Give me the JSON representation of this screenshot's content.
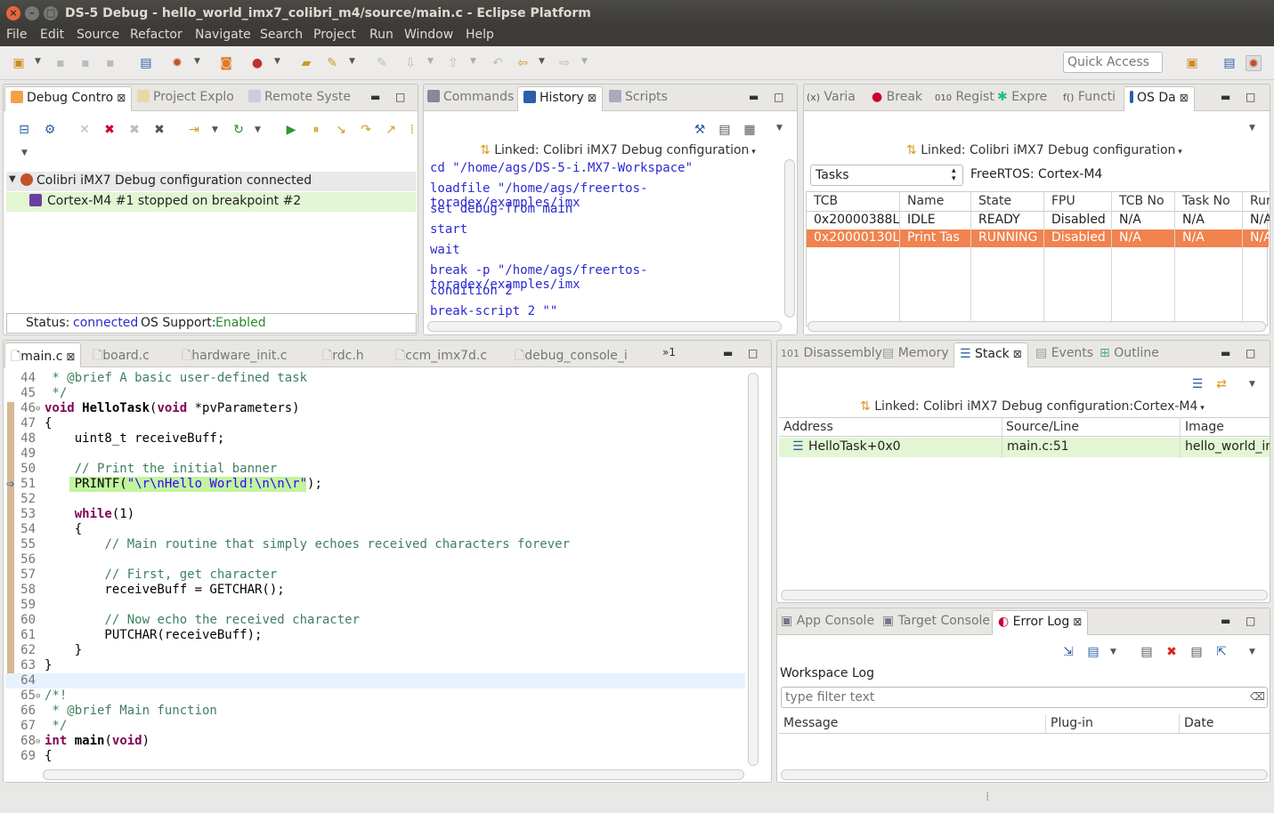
{
  "window": {
    "title": "DS-5 Debug - hello_world_imx7_colibri_m4/source/main.c - Eclipse Platform"
  },
  "menu": [
    "File",
    "Edit",
    "Source",
    "Refactor",
    "Navigate",
    "Search",
    "Project",
    "Run",
    "Window",
    "Help"
  ],
  "toolbar": {
    "quick_access_placeholder": "Quick Access"
  },
  "debug_panel": {
    "tabs": [
      "Debug Contro",
      "Project Explo",
      "Remote Syste"
    ],
    "connection": "Colibri iMX7 Debug configuration connected",
    "target": "Cortex-M4 #1 stopped on breakpoint #2",
    "status_label": "Status:",
    "status_value": "connected",
    "os_label": "OS Support:",
    "os_value": "Enabled"
  },
  "history_panel": {
    "tabs": [
      "Commands",
      "History",
      "Scripts"
    ],
    "linked": "Linked: Colibri iMX7 Debug configuration",
    "commands": [
      "cd \"/home/ags/DS-5-i.MX7-Workspace\"",
      "loadfile \"/home/ags/freertos-toradex/examples/imx",
      "set debug-from main",
      "start",
      "wait",
      "break -p \"/home/ags/freertos-toradex/examples/imx",
      "condition 2",
      "break-script 2 \"\""
    ]
  },
  "os_panel": {
    "tabs": [
      "Varia",
      "Break",
      "Regist",
      "Expre",
      "Functi",
      "OS Da"
    ],
    "linked": "Linked: Colibri iMX7 Debug configuration",
    "select_value": "Tasks",
    "os_name": "FreeRTOS: Cortex-M4",
    "columns": [
      "TCB",
      "Name",
      "State",
      "FPU",
      "TCB No",
      "Task No",
      "Run"
    ],
    "rows": [
      [
        "0x20000388L",
        "IDLE",
        "READY",
        "Disabled",
        "N/A",
        "N/A",
        "N/A"
      ],
      [
        "0x20000130L",
        "Print Tas",
        "RUNNING",
        "Disabled",
        "N/A",
        "N/A",
        "N/A"
      ]
    ]
  },
  "editor": {
    "tabs": [
      "main.c",
      "board.c",
      "hardware_init.c",
      "rdc.h",
      "ccm_imx7d.c",
      "debug_console_i"
    ],
    "overflow": "»1",
    "line_numbers": [
      "44",
      "45",
      "46",
      "47",
      "48",
      "49",
      "50",
      "51",
      "52",
      "53",
      "54",
      "55",
      "56",
      "57",
      "58",
      "59",
      "60",
      "61",
      "62",
      "63",
      "64",
      "65",
      "66",
      "67",
      "68",
      "69"
    ]
  },
  "stack_panel": {
    "tabs": [
      "Disassembly",
      "Memory",
      "Stack",
      "Events",
      "Outline"
    ],
    "linked": "Linked: Colibri iMX7 Debug configuration:Cortex-M4",
    "columns": [
      "Address",
      "Source/Line",
      "Image"
    ],
    "row": [
      "HelloTask+0x0",
      "main.c:51",
      "hello_world_in"
    ]
  },
  "log_panel": {
    "tabs": [
      "App Console",
      "Target Console",
      "Error Log"
    ],
    "title": "Workspace Log",
    "filter_placeholder": "type filter text",
    "columns": [
      "Message",
      "Plug-in",
      "Date"
    ]
  },
  "colors": {
    "accent_orange": "#f0834f",
    "highlight_green": "#e3f6d4",
    "exec_line": "#c2f49e"
  }
}
